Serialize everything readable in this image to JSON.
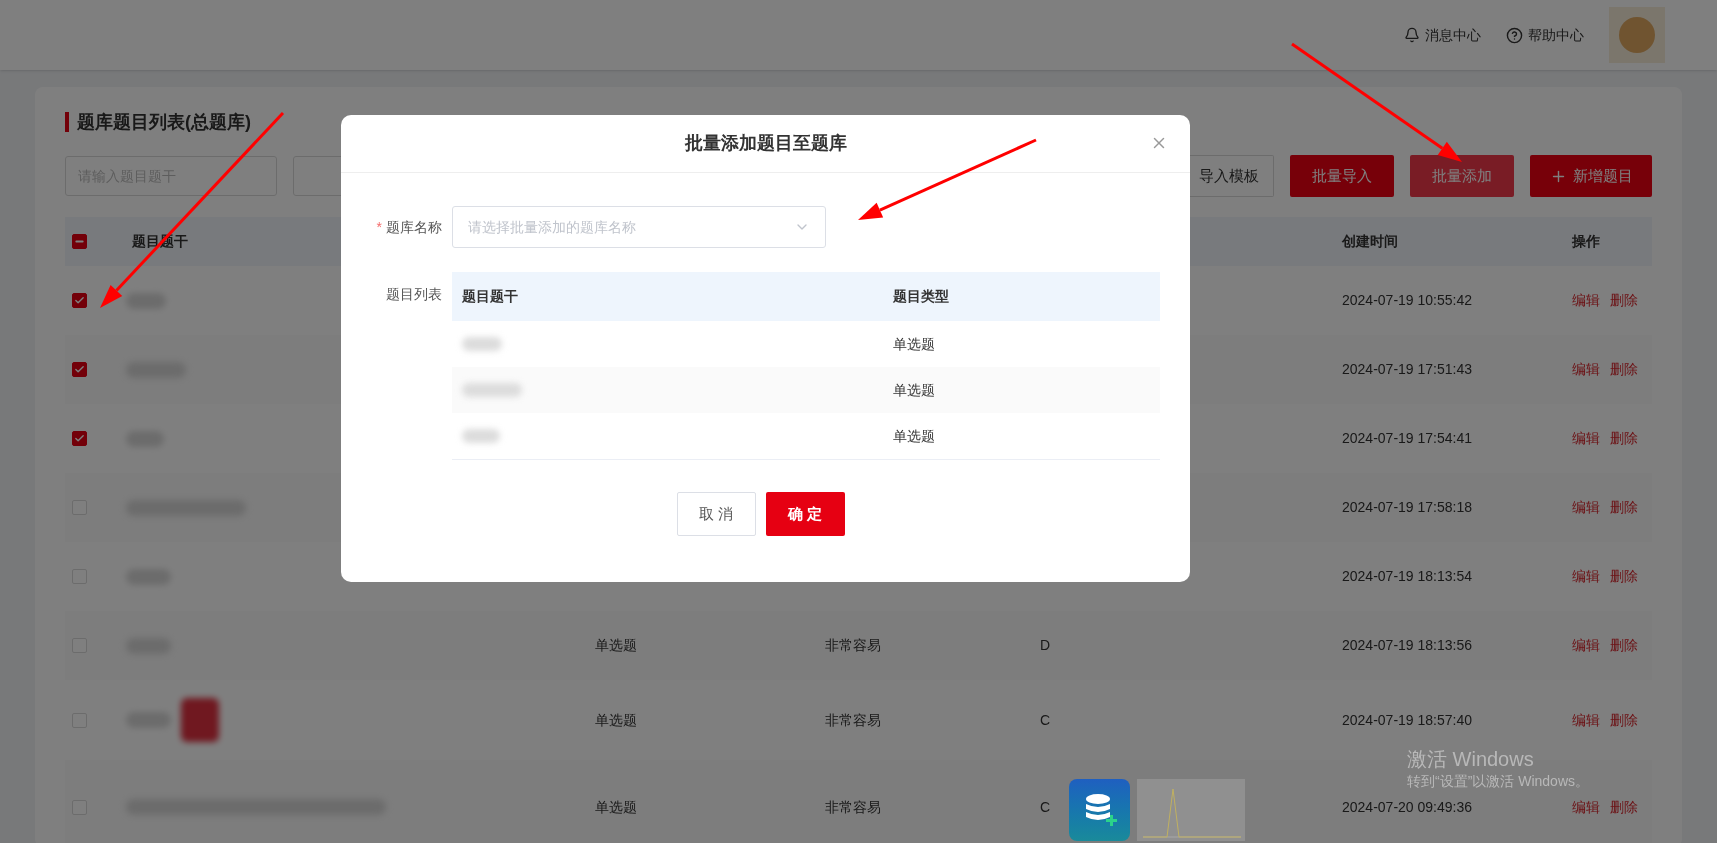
{
  "header": {
    "links": [
      {
        "label": "消息中心"
      },
      {
        "label": "帮助中心"
      }
    ]
  },
  "page": {
    "title": "题库题目列表(总题库)",
    "search": {
      "placeholder": "请输入题目题干"
    },
    "buttons": [
      {
        "label": "导入模板",
        "kind": "outline"
      },
      {
        "label": "批量导入",
        "kind": "primary"
      },
      {
        "label": "批量添加",
        "kind": "hover"
      },
      {
        "label": "新增题目",
        "kind": "add"
      }
    ]
  },
  "table": {
    "header_checkbox": {
      "indeterminate": true
    },
    "columns": {
      "stem": "题目题干",
      "created": "创建时间",
      "actions": "操作"
    },
    "rows": [
      {
        "checked": true,
        "created": "2024-07-19 10:55:42",
        "edit": "编辑",
        "delete": "删除"
      },
      {
        "checked": true,
        "created": "2024-07-19 17:51:43",
        "edit": "编辑",
        "delete": "删除"
      },
      {
        "checked": true,
        "created": "2024-07-19 17:54:41",
        "edit": "编辑",
        "delete": "删除"
      },
      {
        "checked": false,
        "created": "2024-07-19 17:58:18",
        "edit": "编辑",
        "delete": "删除"
      },
      {
        "checked": false,
        "created": "2024-07-19 18:13:54",
        "edit": "编辑",
        "delete": "删除"
      },
      {
        "checked": false,
        "type": "单选题",
        "difficulty": "非常容易",
        "answer": "D",
        "created": "2024-07-19 18:13:56",
        "edit": "编辑",
        "delete": "删除"
      },
      {
        "checked": false,
        "has_image": true,
        "type": "单选题",
        "difficulty": "非常容易",
        "answer": "C",
        "created": "2024-07-19 18:57:40",
        "edit": "编辑",
        "delete": "删除"
      },
      {
        "checked": false,
        "type": "单选题",
        "difficulty": "非常容易",
        "answer": "C",
        "created": "2024-07-20 09:49:36",
        "edit": "编辑",
        "delete": "删除"
      }
    ]
  },
  "modal": {
    "title": "批量添加题目至题库",
    "required_mark": "*",
    "bank_label": "题库名称",
    "select": {
      "placeholder": "请选择批量添加的题库名称"
    },
    "list_label": "题目列表",
    "columns": [
      "题目题干",
      "题目类型"
    ],
    "rows": [
      {
        "type": "单选题"
      },
      {
        "type": "单选题"
      },
      {
        "type": "单选题"
      }
    ],
    "buttons": [
      {
        "label": "取 消",
        "kind": "cancel"
      },
      {
        "label": "确 定",
        "kind": "ok"
      }
    ]
  },
  "os_notice": {
    "title": "激活 Windows",
    "text": "转到“设置”以激活 Windows。"
  }
}
